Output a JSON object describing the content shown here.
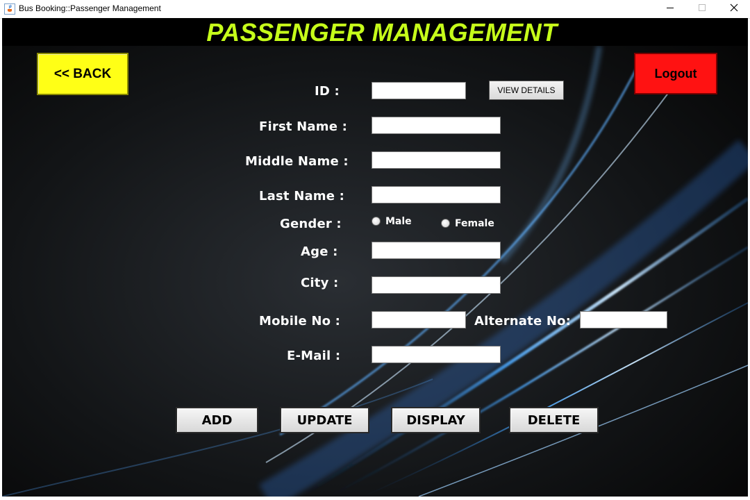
{
  "window": {
    "title": "Bus Booking::Passenger Management",
    "app_icon": "java-cup-icon",
    "controls": {
      "minimize": "minimize-icon",
      "maximize": "maximize-icon",
      "close": "close-icon"
    }
  },
  "header": {
    "title": "PASSENGER MANAGEMENT",
    "title_color": "#c6ff1a"
  },
  "nav": {
    "back_label": "<< BACK",
    "back_color": "#ffff16",
    "logout_label": "Logout",
    "logout_color": "#ff1212"
  },
  "form": {
    "id_label": "ID :",
    "id_value": "",
    "view_details_label": "VIEW DETAILS",
    "first_name_label": "First Name :",
    "first_name_value": "",
    "middle_name_label": "Middle Name :",
    "middle_name_value": "",
    "last_name_label": "Last Name :",
    "last_name_value": "",
    "gender_label": "Gender :",
    "gender_options": [
      "Male",
      "Female"
    ],
    "gender_selected": null,
    "age_label": "Age :",
    "age_value": "",
    "city_label": "City :",
    "city_value": "",
    "mobile_label": "Mobile No :",
    "mobile_value": "",
    "alternate_label": "Alternate No:",
    "alternate_value": "",
    "email_label": "E-Mail :",
    "email_value": ""
  },
  "actions": {
    "add": "ADD",
    "update": "UPDATE",
    "display": "DISPLAY",
    "delete": "DELETE"
  }
}
